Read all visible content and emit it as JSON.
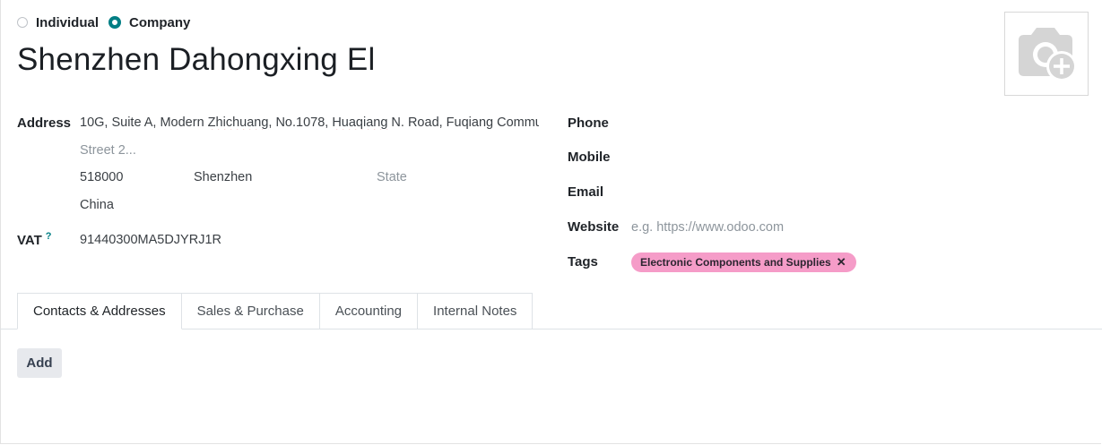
{
  "company_type": {
    "options": [
      {
        "label": "Individual",
        "selected": false
      },
      {
        "label": "Company",
        "selected": true
      }
    ]
  },
  "partner": {
    "name": "Shenzhen Dahongxing Ele"
  },
  "address": {
    "label": "Address",
    "street_parts": [
      "10G, Suite A, Modern ",
      "Zhichuang",
      ", No.1078, ",
      "Huaqiang",
      " N. Road, Fuqiang Commu"
    ],
    "street2_placeholder": "Street 2...",
    "zip": "518000",
    "city": "Shenzhen",
    "state_placeholder": "State",
    "country": "China"
  },
  "vat": {
    "label": "VAT",
    "help": "?",
    "value": "91440300MA5DJYRJ1R"
  },
  "contact": {
    "phone_label": "Phone",
    "mobile_label": "Mobile",
    "email_label": "Email",
    "website_label": "Website",
    "website_placeholder": "e.g. https://www.odoo.com",
    "tags_label": "Tags",
    "tags": [
      {
        "label": "Electronic Components and Supplies",
        "remove": "✕",
        "color": "#f59cc8"
      }
    ]
  },
  "tabs": [
    {
      "label": "Contacts & Addresses",
      "active": true
    },
    {
      "label": "Sales & Purchase",
      "active": false
    },
    {
      "label": "Accounting",
      "active": false
    },
    {
      "label": "Internal Notes",
      "active": false
    }
  ],
  "contacts": {
    "add_label": "Add"
  },
  "colors": {
    "primary": "#017e84",
    "tag": "#f59cc8"
  }
}
